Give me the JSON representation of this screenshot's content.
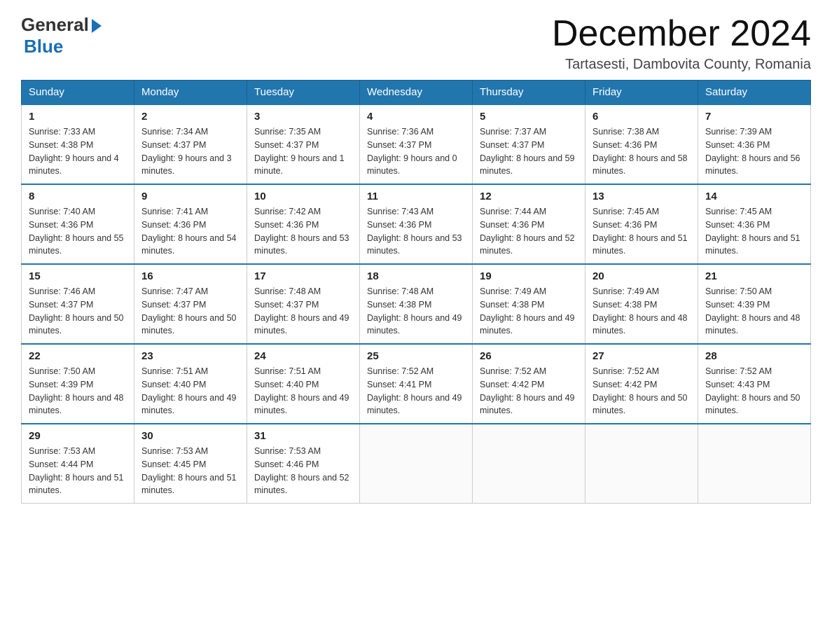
{
  "logo": {
    "general": "General",
    "blue": "Blue"
  },
  "title": "December 2024",
  "location": "Tartasesti, Dambovita County, Romania",
  "days_header": [
    "Sunday",
    "Monday",
    "Tuesday",
    "Wednesday",
    "Thursday",
    "Friday",
    "Saturday"
  ],
  "weeks": [
    [
      {
        "day": "1",
        "sunrise": "7:33 AM",
        "sunset": "4:38 PM",
        "daylight": "9 hours and 4 minutes."
      },
      {
        "day": "2",
        "sunrise": "7:34 AM",
        "sunset": "4:37 PM",
        "daylight": "9 hours and 3 minutes."
      },
      {
        "day": "3",
        "sunrise": "7:35 AM",
        "sunset": "4:37 PM",
        "daylight": "9 hours and 1 minute."
      },
      {
        "day": "4",
        "sunrise": "7:36 AM",
        "sunset": "4:37 PM",
        "daylight": "9 hours and 0 minutes."
      },
      {
        "day": "5",
        "sunrise": "7:37 AM",
        "sunset": "4:37 PM",
        "daylight": "8 hours and 59 minutes."
      },
      {
        "day": "6",
        "sunrise": "7:38 AM",
        "sunset": "4:36 PM",
        "daylight": "8 hours and 58 minutes."
      },
      {
        "day": "7",
        "sunrise": "7:39 AM",
        "sunset": "4:36 PM",
        "daylight": "8 hours and 56 minutes."
      }
    ],
    [
      {
        "day": "8",
        "sunrise": "7:40 AM",
        "sunset": "4:36 PM",
        "daylight": "8 hours and 55 minutes."
      },
      {
        "day": "9",
        "sunrise": "7:41 AM",
        "sunset": "4:36 PM",
        "daylight": "8 hours and 54 minutes."
      },
      {
        "day": "10",
        "sunrise": "7:42 AM",
        "sunset": "4:36 PM",
        "daylight": "8 hours and 53 minutes."
      },
      {
        "day": "11",
        "sunrise": "7:43 AM",
        "sunset": "4:36 PM",
        "daylight": "8 hours and 53 minutes."
      },
      {
        "day": "12",
        "sunrise": "7:44 AM",
        "sunset": "4:36 PM",
        "daylight": "8 hours and 52 minutes."
      },
      {
        "day": "13",
        "sunrise": "7:45 AM",
        "sunset": "4:36 PM",
        "daylight": "8 hours and 51 minutes."
      },
      {
        "day": "14",
        "sunrise": "7:45 AM",
        "sunset": "4:36 PM",
        "daylight": "8 hours and 51 minutes."
      }
    ],
    [
      {
        "day": "15",
        "sunrise": "7:46 AM",
        "sunset": "4:37 PM",
        "daylight": "8 hours and 50 minutes."
      },
      {
        "day": "16",
        "sunrise": "7:47 AM",
        "sunset": "4:37 PM",
        "daylight": "8 hours and 50 minutes."
      },
      {
        "day": "17",
        "sunrise": "7:48 AM",
        "sunset": "4:37 PM",
        "daylight": "8 hours and 49 minutes."
      },
      {
        "day": "18",
        "sunrise": "7:48 AM",
        "sunset": "4:38 PM",
        "daylight": "8 hours and 49 minutes."
      },
      {
        "day": "19",
        "sunrise": "7:49 AM",
        "sunset": "4:38 PM",
        "daylight": "8 hours and 49 minutes."
      },
      {
        "day": "20",
        "sunrise": "7:49 AM",
        "sunset": "4:38 PM",
        "daylight": "8 hours and 48 minutes."
      },
      {
        "day": "21",
        "sunrise": "7:50 AM",
        "sunset": "4:39 PM",
        "daylight": "8 hours and 48 minutes."
      }
    ],
    [
      {
        "day": "22",
        "sunrise": "7:50 AM",
        "sunset": "4:39 PM",
        "daylight": "8 hours and 48 minutes."
      },
      {
        "day": "23",
        "sunrise": "7:51 AM",
        "sunset": "4:40 PM",
        "daylight": "8 hours and 49 minutes."
      },
      {
        "day": "24",
        "sunrise": "7:51 AM",
        "sunset": "4:40 PM",
        "daylight": "8 hours and 49 minutes."
      },
      {
        "day": "25",
        "sunrise": "7:52 AM",
        "sunset": "4:41 PM",
        "daylight": "8 hours and 49 minutes."
      },
      {
        "day": "26",
        "sunrise": "7:52 AM",
        "sunset": "4:42 PM",
        "daylight": "8 hours and 49 minutes."
      },
      {
        "day": "27",
        "sunrise": "7:52 AM",
        "sunset": "4:42 PM",
        "daylight": "8 hours and 50 minutes."
      },
      {
        "day": "28",
        "sunrise": "7:52 AM",
        "sunset": "4:43 PM",
        "daylight": "8 hours and 50 minutes."
      }
    ],
    [
      {
        "day": "29",
        "sunrise": "7:53 AM",
        "sunset": "4:44 PM",
        "daylight": "8 hours and 51 minutes."
      },
      {
        "day": "30",
        "sunrise": "7:53 AM",
        "sunset": "4:45 PM",
        "daylight": "8 hours and 51 minutes."
      },
      {
        "day": "31",
        "sunrise": "7:53 AM",
        "sunset": "4:46 PM",
        "daylight": "8 hours and 52 minutes."
      },
      null,
      null,
      null,
      null
    ]
  ]
}
